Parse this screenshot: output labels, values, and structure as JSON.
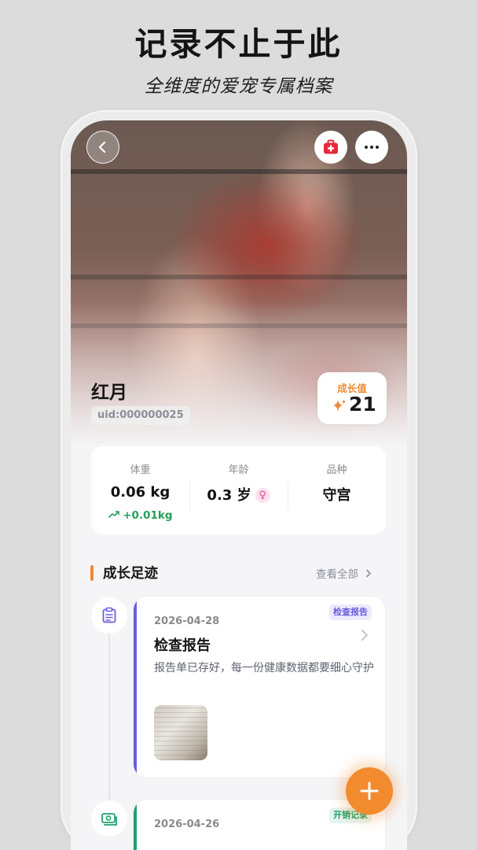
{
  "promo": {
    "headline": "记录不止于此",
    "subline": "全维度的爱宠专属档案"
  },
  "header": {
    "back_icon": "chevron-left-icon",
    "medical_icon": "first-aid-kit-icon",
    "more_icon": "ellipsis-icon"
  },
  "pet": {
    "name": "红月",
    "uid": "uid:000000025",
    "growth_label": "成长值",
    "growth_value": "21"
  },
  "stats": {
    "weight_label": "体重",
    "weight_value": "0.06 kg",
    "weight_delta": "+0.01kg",
    "age_label": "年龄",
    "age_value": "0.3 岁",
    "gender_symbol": "♀",
    "breed_label": "品种",
    "breed_value": "守宫"
  },
  "timeline": {
    "title": "成长足迹",
    "view_all": "查看全部",
    "records": [
      {
        "icon": "clipboard-icon",
        "tag": "检查报告",
        "date": "2026-04-28",
        "title": "检查报告",
        "desc": "报告单已存好，每一份健康数据都要细心守护"
      },
      {
        "icon": "money-icon",
        "tag": "开销记录",
        "date": "2026-04-26"
      }
    ]
  },
  "colors": {
    "accent_orange": "#f28a2e",
    "report_purple": "#6a5fdb",
    "expense_green": "#21a06a",
    "delta_green": "#24a05a"
  },
  "fab": {
    "icon": "plus-icon"
  }
}
